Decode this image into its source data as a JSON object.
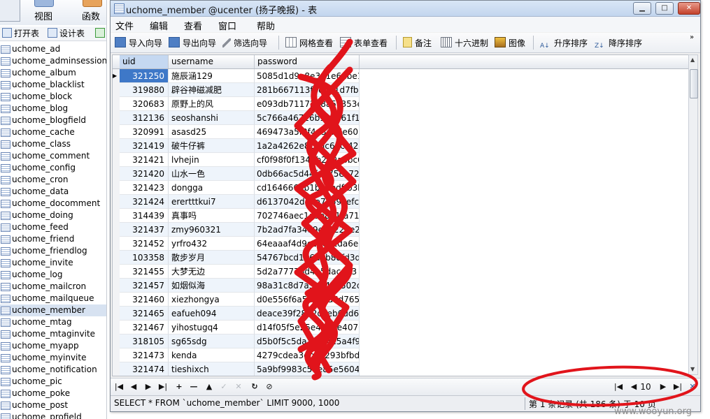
{
  "left_pane": {
    "big_buttons": [
      "视图",
      "函数"
    ],
    "toolbar": {
      "open_table": "打开表",
      "design_table": "设计表"
    },
    "tables": [
      "uchome_ad",
      "uchome_adminsession",
      "uchome_album",
      "uchome_blacklist",
      "uchome_block",
      "uchome_blog",
      "uchome_blogfield",
      "uchome_cache",
      "uchome_class",
      "uchome_comment",
      "uchome_config",
      "uchome_cron",
      "uchome_data",
      "uchome_docomment",
      "uchome_doing",
      "uchome_feed",
      "uchome_friend",
      "uchome_friendlog",
      "uchome_invite",
      "uchome_log",
      "uchome_mailcron",
      "uchome_mailqueue",
      "uchome_member",
      "uchome_mtag",
      "uchome_mtaginvite",
      "uchome_myapp",
      "uchome_myinvite",
      "uchome_notification",
      "uchome_pic",
      "uchome_poke",
      "uchome_post",
      "uchome_profield"
    ],
    "selected_table": "uchome_member"
  },
  "window": {
    "title": "uchome_member @ucenter (扬子晚报) - 表",
    "controls": {
      "minimize": "▁",
      "maximize": "□",
      "close": "✕"
    }
  },
  "menu": [
    "文件",
    "编辑",
    "查看",
    "窗口",
    "帮助"
  ],
  "toolbar": {
    "import_wizard": "导入向导",
    "export_wizard": "导出向导",
    "filter_wizard": "筛选向导",
    "grid_view": "网格查看",
    "form_view": "表单查看",
    "memo": "备注",
    "hex": "十六进制",
    "image": "图像",
    "sort_asc": "升序排序",
    "sort_desc": "降序排序",
    "more": "»"
  },
  "grid": {
    "columns": [
      "uid",
      "username",
      "password"
    ],
    "rows": [
      [
        "321250",
        "施辰涵129",
        "5085d1d9e8e3e1e6dbe14f1"
      ],
      [
        "319880",
        "辟谷神磁减肥",
        "281b667113f6d3e1d7fb7c1"
      ],
      [
        "320683",
        "原野上的风",
        "e093db71172d8a5c353e057"
      ],
      [
        "312136",
        "seoshanshi",
        "5c766a46726b1e5d61f1890"
      ],
      [
        "320991",
        "asasd25",
        "469473a5f3f4e3db7e60be79"
      ],
      [
        "321419",
        "破牛仔裤",
        "1a2a4262e8c3dc65cf4209a"
      ],
      [
        "321421",
        "lvhejin",
        "cf0f98f0f1340b2e0a8bc6b"
      ],
      [
        "321420",
        "山水一色",
        "0db66ac5d44fd975ec72c"
      ],
      [
        "321423",
        "dongga",
        "cd164666db1b07edffb3bb"
      ],
      [
        "321424",
        "erertttkui7",
        "d6137042d4ea7a59cefc5f"
      ],
      [
        "314439",
        "真事吗",
        "702746aec1a3e8e1fa71a"
      ],
      [
        "321437",
        "zmy960321",
        "7b2ad7fa34d9ea3222e2de6"
      ],
      [
        "321452",
        "yrfro432",
        "64eaaaf4d9c1b0ecda6ed9"
      ],
      [
        "103358",
        "散步岁月",
        "54767bcd1b6d2b88fd3d19"
      ],
      [
        "321455",
        "大梦无边",
        "5d2a77776d4a5dacd63"
      ],
      [
        "321457",
        "如烟似海",
        "98a31c8d7a5be4a4502d00"
      ],
      [
        "321460",
        "xiezhongya",
        "d0e556f6a5ac92a6d765f8"
      ],
      [
        "321465",
        "eafueh094",
        "deace39f2852c6eb6dd66"
      ],
      [
        "321467",
        "yihostugq4",
        "d14f05f5e25e48d2e4070"
      ],
      [
        "318105",
        "sg65sdg",
        "d5b0f5c5da3f584e5a4f9"
      ],
      [
        "321473",
        "kenda",
        "4279cdea3eb6a293bfbdd2"
      ],
      [
        "321474",
        "tieshixch",
        "5a9bf9983c56e85e5604c6"
      ]
    ],
    "current_row_marker": "▶"
  },
  "navbar": {
    "buttons": [
      "|◀",
      "◀",
      "▶",
      "▶|",
      "+",
      "—",
      "▲",
      "✓",
      "✕",
      "↻",
      "⊘"
    ],
    "page_first": "|◀",
    "page_prev": "◀",
    "page_number": "10",
    "page_next": "▶",
    "page_last": "▶|"
  },
  "status": {
    "sql": "SELECT * FROM `uchome_member` LIMIT 9000, 1000",
    "records": "第 1 条记录 (共 186 条) 于 10 页"
  },
  "watermark": "www.wooyun.org",
  "colors": {
    "selection": "#3e78c8",
    "scribble": "#e1141b",
    "row_alt": "#eef4fb"
  }
}
